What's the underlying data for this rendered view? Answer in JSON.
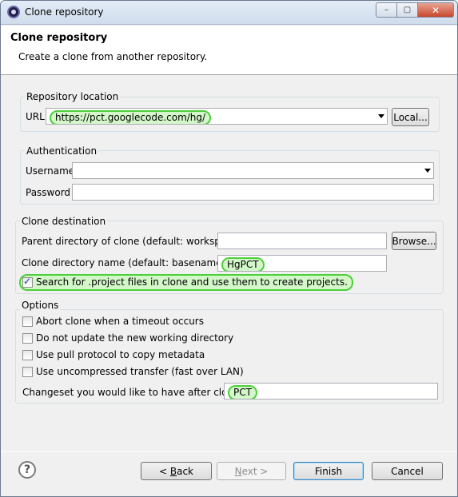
{
  "window": {
    "title": "Clone repository",
    "min_label": "–",
    "max_label": "▢",
    "close_label": "✕"
  },
  "header": {
    "title": "Clone repository",
    "description": "Create a clone from another repository."
  },
  "repository_location": {
    "label": "Repository location",
    "url_label": "URL",
    "url_value": "https://pct.googlecode.com/hg/",
    "local_button": "Local..."
  },
  "authentication": {
    "label": "Authentication",
    "username_label": "Username",
    "username_value": "",
    "password_label": "Password",
    "password_value": ""
  },
  "clone_destination": {
    "label": "Clone destination",
    "parent_dir_label": "Parent directory of clone (default: workspace)",
    "parent_dir_value": "",
    "browse_button": "Browse...",
    "clone_dir_label": "Clone directory name (default: basename)",
    "clone_dir_value": "HgPCT",
    "search_project_label": "Search for .project files in clone and use them to create projects.",
    "search_project_checked": true
  },
  "options": {
    "label": "Options",
    "items": [
      {
        "label": "Abort clone when a timeout occurs",
        "checked": false
      },
      {
        "label": "Do not update the new working directory",
        "checked": false
      },
      {
        "label": "Use pull protocol to copy metadata",
        "checked": false
      },
      {
        "label": "Use uncompressed transfer (fast over LAN)",
        "checked": false
      }
    ],
    "changeset_label": "Changeset you would like to have after cloning",
    "changeset_value": "PCT"
  },
  "footer": {
    "help_icon": "?",
    "back_prefix": "< ",
    "back_key": "B",
    "back_rest": "ack",
    "next_key": "N",
    "next_rest": "ext >",
    "finish": "Finish",
    "cancel": "Cancel"
  },
  "colors": {
    "highlight_fill": "#d3f7c9",
    "highlight_border": "#4ccf3a"
  }
}
